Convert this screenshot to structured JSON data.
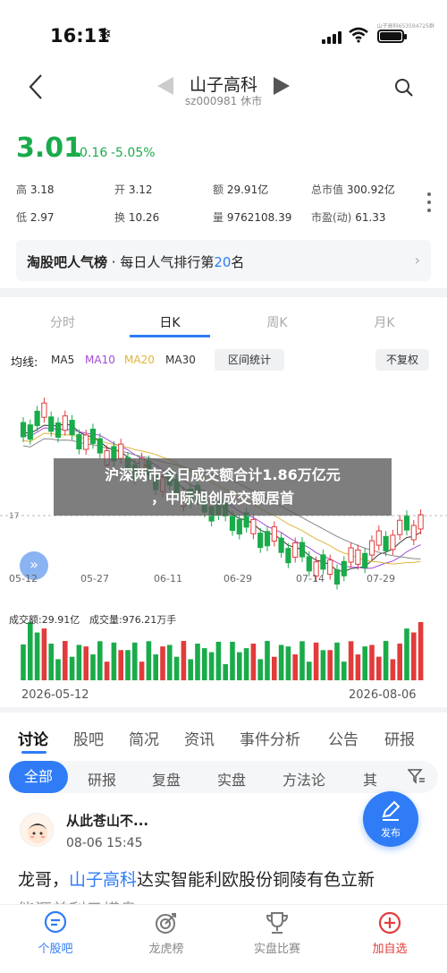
{
  "status_bar": {
    "time": "16:11",
    "watermark": "山子高科653594725群"
  },
  "header": {
    "title": "山子高科",
    "subtitle": "sz000981 休市"
  },
  "quote": {
    "price": "3.01",
    "change": "-0.16",
    "change_pct": "-5.05%",
    "fields": [
      {
        "k": "高",
        "v": "3.18"
      },
      {
        "k": "开",
        "v": "3.12"
      },
      {
        "k": "额",
        "v": "29.91亿"
      },
      {
        "k": "总市值",
        "v": "300.92亿"
      },
      {
        "k": "低",
        "v": "2.97"
      },
      {
        "k": "换",
        "v": "10.26"
      },
      {
        "k": "量",
        "v": "9762108.39"
      },
      {
        "k": "市盈(动)",
        "v": "61.33"
      }
    ]
  },
  "rank": {
    "label": "淘股吧人气榜",
    "sep": " · 每日人气排行第",
    "num": "20",
    "suffix": "名"
  },
  "chart_tabs": [
    "分时",
    "日K",
    "周K",
    "月K"
  ],
  "ma": {
    "label": "均线:",
    "items": [
      "MA5",
      "MA10",
      "MA20",
      "MA30"
    ],
    "range_btn": "区间统计",
    "adjust_btn": "不复权"
  },
  "chart_data": {
    "type": "candlestick",
    "y_marker": "17",
    "x_labels": [
      "05-12",
      "05-27",
      "06-11",
      "06-29",
      "07-14",
      "07-29"
    ],
    "volume_label": "成交额:29.91亿",
    "volume_qty": "成交量:976.21万手",
    "start_date": "2026-05-12",
    "end_date": "2026-08-06"
  },
  "banner": {
    "line1": "沪深两市今日成交额合计1.86万亿元",
    "line2": "，中际旭创成交额居首"
  },
  "discussion_tabs": [
    "讨论",
    "股吧",
    "简况",
    "资讯",
    "事件分析",
    "公告",
    "研报"
  ],
  "filters": [
    "全部",
    "研报",
    "复盘",
    "实盘",
    "方法论",
    "其"
  ],
  "post": {
    "author": "从此苍山不...",
    "time": "08-06 15:45",
    "text_pre": "龙哥，",
    "text_link": "山子高科",
    "text_post": "达实智能利欧股份铜陵有色立新",
    "text2": "能源美利云横盘"
  },
  "fab": {
    "label": "发布"
  },
  "bottom_nav": [
    "个股吧",
    "龙虎榜",
    "实盘比赛",
    "加自选"
  ],
  "colors": {
    "up": "#e23b3b",
    "down": "#1aab4b",
    "accent": "#2f7cf6"
  }
}
